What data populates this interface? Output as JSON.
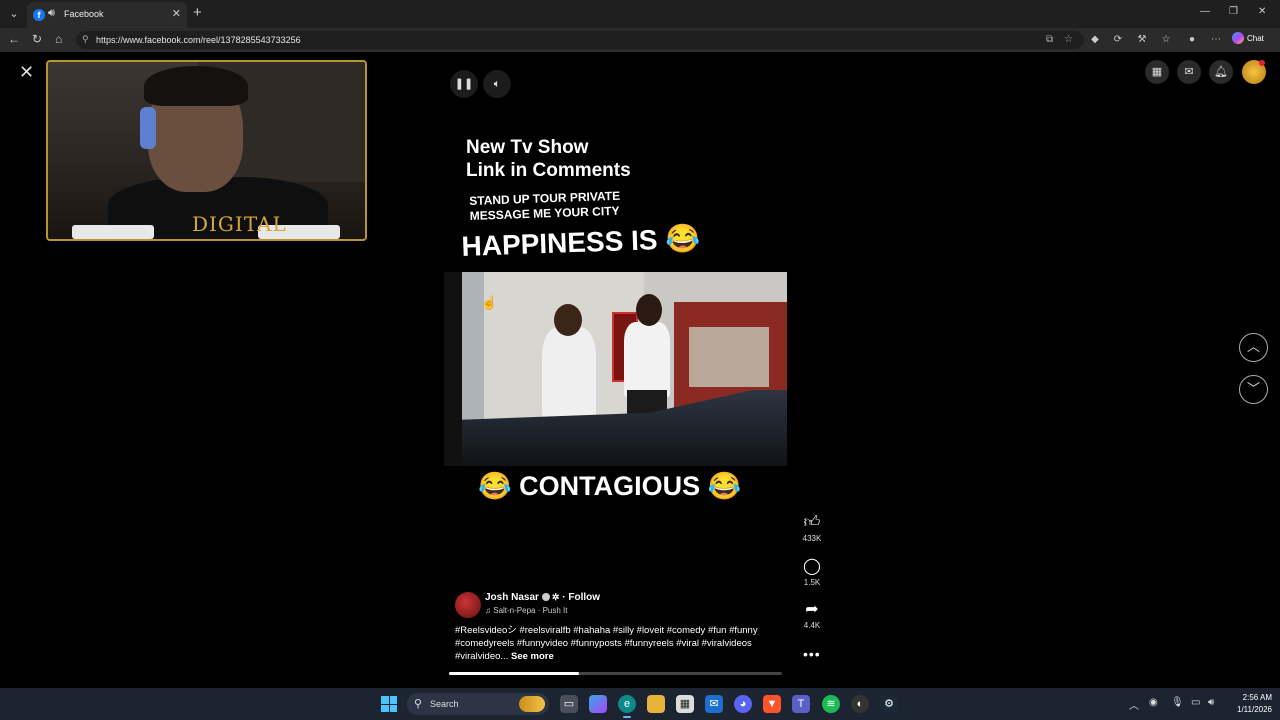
{
  "browser": {
    "tab_title": "Facebook",
    "tab_favicon_letter": "f",
    "url": "https://www.facebook.com/reel/1378285543733256",
    "chat_label": "Chat"
  },
  "reel": {
    "caption_line1": "New Tv Show",
    "caption_line2": "Link in Comments",
    "caption_small_line1": "STAND UP TOUR PRIVATE",
    "caption_small_line2": "MESSAGE ME YOUR CITY",
    "caption_big_top": "HAPPINESS IS 😂",
    "caption_big_bottom": "😂 CONTAGIOUS 😂",
    "author_name": "Josh Nasar",
    "follow_label": "Follow",
    "music": "Salt-n-Pepa · Push It",
    "description": "#Reelsvideoシ #reelsviralfb #hahaha #silly #loveit #comedy #fun #funny #comedyreels #funnyvideo #funnyposts #funnyreels #viral #viralvideos #viralvideo...",
    "see_more": "See more",
    "likes": "433K",
    "comments": "1.5K",
    "shares": "4.4K",
    "progress_fraction": 0.39
  },
  "webcam": {
    "logo_text": "DIGITAL"
  },
  "taskbar": {
    "search_label": "Search",
    "time": "2:56 AM",
    "date": "1/11/2026"
  },
  "icons": {
    "close": "close-icon",
    "pause": "pause-icon",
    "volume": "volume-icon",
    "like": "like-icon",
    "comment": "comment-icon",
    "share": "share-icon",
    "more": "more-icon",
    "prev": "chevron-up-icon",
    "next": "chevron-down-icon"
  },
  "colors": {
    "facebook_blue": "#1877f2",
    "webcam_border": "#b8962e",
    "taskbar_bg": "#1c2331",
    "notification_red": "#e41e3f"
  }
}
